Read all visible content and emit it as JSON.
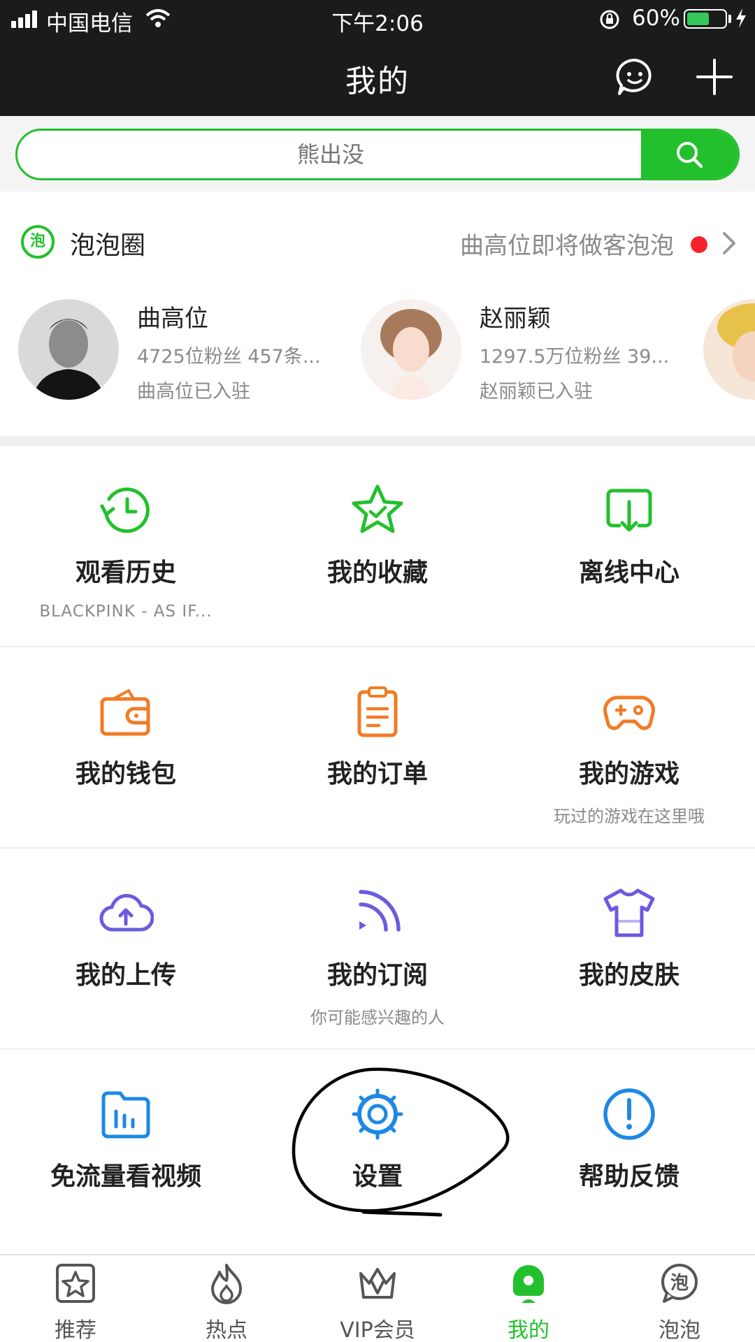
{
  "status_bar": {
    "carrier": "中国电信",
    "time": "下午2:06",
    "battery_percent": "60%",
    "battery_level": 0.6,
    "icons": [
      "signal-icon",
      "wifi-icon",
      "rotation-lock-icon",
      "battery-icon",
      "charging-icon"
    ]
  },
  "header": {
    "title": "我的",
    "actions": [
      {
        "icon": "message-bubble-icon"
      },
      {
        "icon": "plus-icon"
      }
    ]
  },
  "search": {
    "placeholder": "熊出没",
    "button_icon": "search-icon",
    "accent": "#22c02c"
  },
  "paopao": {
    "icon": "paopao-logo-icon",
    "logo_text": "泡",
    "title": "泡泡圈",
    "notice": "曲高位即将做客泡泡",
    "celebrities": [
      {
        "name": "曲高位",
        "meta": "4725位粉丝 457条...",
        "joined": "曲高位已入驻"
      },
      {
        "name": "赵丽颖",
        "meta": "1297.5万位粉丝 39...",
        "joined": "赵丽颖已入驻"
      }
    ]
  },
  "menu": {
    "rows": [
      [
        {
          "label": "观看历史",
          "sub": "BLACKPINK - AS IF...",
          "icon": "history-clock-icon",
          "color": "#22c02c"
        },
        {
          "label": "我的收藏",
          "sub": "",
          "icon": "star-check-icon",
          "color": "#22c02c"
        },
        {
          "label": "离线中心",
          "sub": "",
          "icon": "download-box-icon",
          "color": "#22c02c"
        }
      ],
      [
        {
          "label": "我的钱包",
          "sub": "",
          "icon": "wallet-icon",
          "color": "#f07b25"
        },
        {
          "label": "我的订单",
          "sub": "",
          "icon": "clipboard-icon",
          "color": "#f07b25"
        },
        {
          "label": "我的游戏",
          "sub": "玩过的游戏在这里哦",
          "icon": "gamepad-icon",
          "color": "#f07b25"
        }
      ],
      [
        {
          "label": "我的上传",
          "sub": "",
          "icon": "cloud-upload-icon",
          "color": "#6a5be0"
        },
        {
          "label": "我的订阅",
          "sub": "你可能感兴趣的人",
          "icon": "rss-feed-icon",
          "color": "#6a5be0"
        },
        {
          "label": "我的皮肤",
          "sub": "",
          "icon": "tshirt-icon",
          "color": "#6a5be0"
        }
      ],
      [
        {
          "label": "免流量看视频",
          "sub": "",
          "icon": "data-folder-icon",
          "color": "#1e88e5"
        },
        {
          "label": "设置",
          "sub": "",
          "icon": "settings-gear-icon",
          "color": "#1e88e5"
        },
        {
          "label": "帮助反馈",
          "sub": "",
          "icon": "help-exclamation-icon",
          "color": "#1e88e5"
        }
      ]
    ]
  },
  "tabbar": {
    "items": [
      {
        "label": "推荐",
        "icon": "recommend-star-icon"
      },
      {
        "label": "热点",
        "icon": "flame-icon"
      },
      {
        "label": "VIP会员",
        "icon": "vip-crown-icon"
      },
      {
        "label": "我的",
        "icon": "profile-icon",
        "active": true
      },
      {
        "label": "泡泡",
        "icon": "paopao-bubble-icon"
      }
    ],
    "logo_text": "泡",
    "active_color": "#22c02c"
  }
}
